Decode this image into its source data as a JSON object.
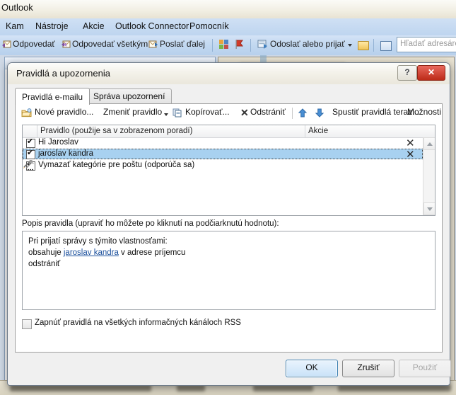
{
  "host": {
    "app_title": "Outlook",
    "menu": [
      {
        "label": "Kam",
        "accel": "K"
      },
      {
        "label": "Nástroje",
        "accel": "N"
      },
      {
        "label": "Akcie",
        "accel": "e"
      },
      {
        "label": "Outlook Connector",
        "accel": "u"
      },
      {
        "label": "Pomocník",
        "accel": "o"
      }
    ],
    "toolbar": [
      {
        "label": "Odpovedať",
        "icon": "reply-icon"
      },
      {
        "label": "Odpovedať všetkým",
        "icon": "reply-all-icon"
      },
      {
        "label": "Poslať ďalej",
        "icon": "forward-icon"
      },
      {
        "label": "Odoslať alebo prijať",
        "icon": "send-receive-icon"
      }
    ],
    "categorize_icon": "categorize-icon",
    "flag_icon": "flag-icon",
    "folder_icon": "folder-icon",
    "address_book_icon": "address-book-icon",
    "search_placeholder": "Hľadať adresáre"
  },
  "dialog": {
    "title": "Pravidlá a upozornenia",
    "help_button": "?",
    "close_button": "✕",
    "tabs": [
      {
        "label": "Pravidlá e-mailu",
        "active": true
      },
      {
        "label": "Správa upozornení",
        "active": false
      }
    ],
    "toolbar": [
      {
        "label": "Nové pravidlo...",
        "icon": "new-rule-icon",
        "accel": "N",
        "has_caret": false
      },
      {
        "label": "Zmeniť pravidlo",
        "icon": "",
        "accel": "e",
        "has_caret": true
      },
      {
        "label": "Kopírovať...",
        "icon": "copy-icon",
        "accel": "K",
        "has_caret": false
      },
      {
        "label": "Odstrániť",
        "icon": "delete-x-icon",
        "accel": "s",
        "has_caret": false
      },
      {
        "label": "Spustiť pravidlá teraz...",
        "icon": "",
        "accel": "r",
        "has_caret": false
      },
      {
        "label": "Možnosti",
        "icon": "",
        "accel": "t",
        "has_caret": false
      }
    ],
    "move_up_icon": "arrow-up-icon",
    "move_down_icon": "arrow-down-icon",
    "list": {
      "columns": [
        "Pravidlo (použije sa v zobrazenom poradí)",
        "Akcie"
      ],
      "rows": [
        {
          "checked": true,
          "name": "Hi Jaroslav",
          "action_icon": "delete-x-icon",
          "selected": false
        },
        {
          "checked": true,
          "name": "jaroslav kandra",
          "action_icon": "delete-x-icon",
          "selected": true
        },
        {
          "checked": true,
          "name": "Vymazať kategórie pre poštu (odporúča sa)",
          "action_icon": "tools-icon",
          "selected": false
        }
      ]
    },
    "description": {
      "label": "Popis pravidla (upraviť ho môžete po kliknutí na podčiarknutú hodnotu):",
      "line1": "Pri prijatí správy s týmito vlastnosťami:",
      "line2_prefix": "obsahuje ",
      "line2_link": "jaroslav kandra",
      "line2_suffix": " v adrese príjemcu",
      "line3": "odstrániť"
    },
    "rss_checkbox": {
      "checked": false,
      "label": "Zapnúť pravidlá na všetkých informačných kánáloch RSS"
    },
    "buttons": {
      "ok": "OK",
      "cancel": "Zrušiť",
      "apply": "Použiť"
    }
  },
  "colors": {
    "selection": "#a8d1f0",
    "link": "#1a4f9c",
    "accent_close": "#bc2a18",
    "default_button_border": "#3c7fb1"
  }
}
